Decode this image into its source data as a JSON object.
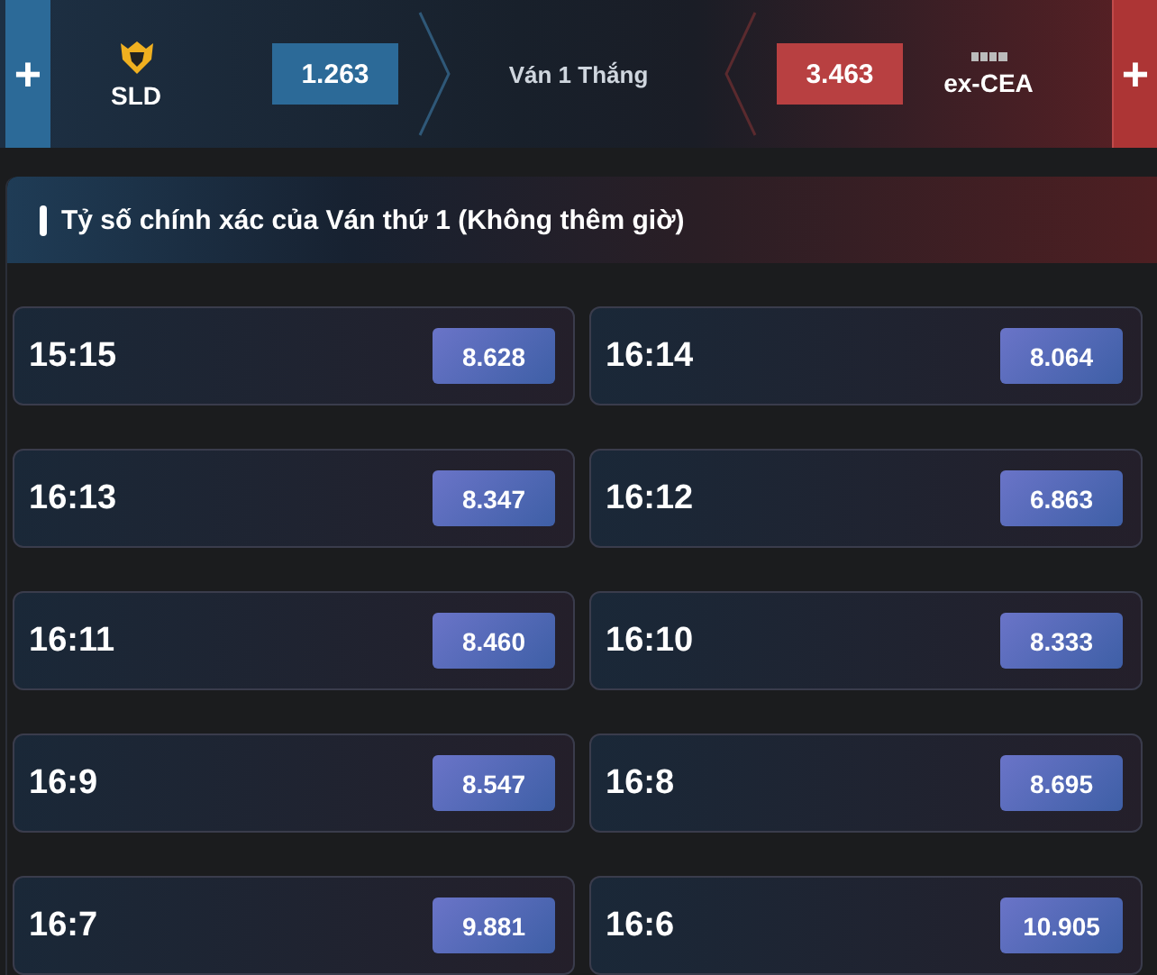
{
  "match": {
    "home": {
      "add": "+",
      "name": "SLD",
      "odds": "1.263"
    },
    "center": "Ván 1 Thắng",
    "away": {
      "add": "+",
      "name": "ex-CEA",
      "odds": "3.463"
    }
  },
  "market": {
    "title": "Tỷ số chính xác của Ván thứ 1 (Không thêm giờ)",
    "options": [
      {
        "score": "15:15",
        "odds": "8.628"
      },
      {
        "score": "16:14",
        "odds": "8.064"
      },
      {
        "score": "16:13",
        "odds": "8.347"
      },
      {
        "score": "16:12",
        "odds": "6.863"
      },
      {
        "score": "16:11",
        "odds": "8.460"
      },
      {
        "score": "16:10",
        "odds": "8.333"
      },
      {
        "score": "16:9",
        "odds": "8.547"
      },
      {
        "score": "16:8",
        "odds": "8.695"
      },
      {
        "score": "16:7",
        "odds": "9.881"
      },
      {
        "score": "16:6",
        "odds": "10.905"
      }
    ]
  }
}
